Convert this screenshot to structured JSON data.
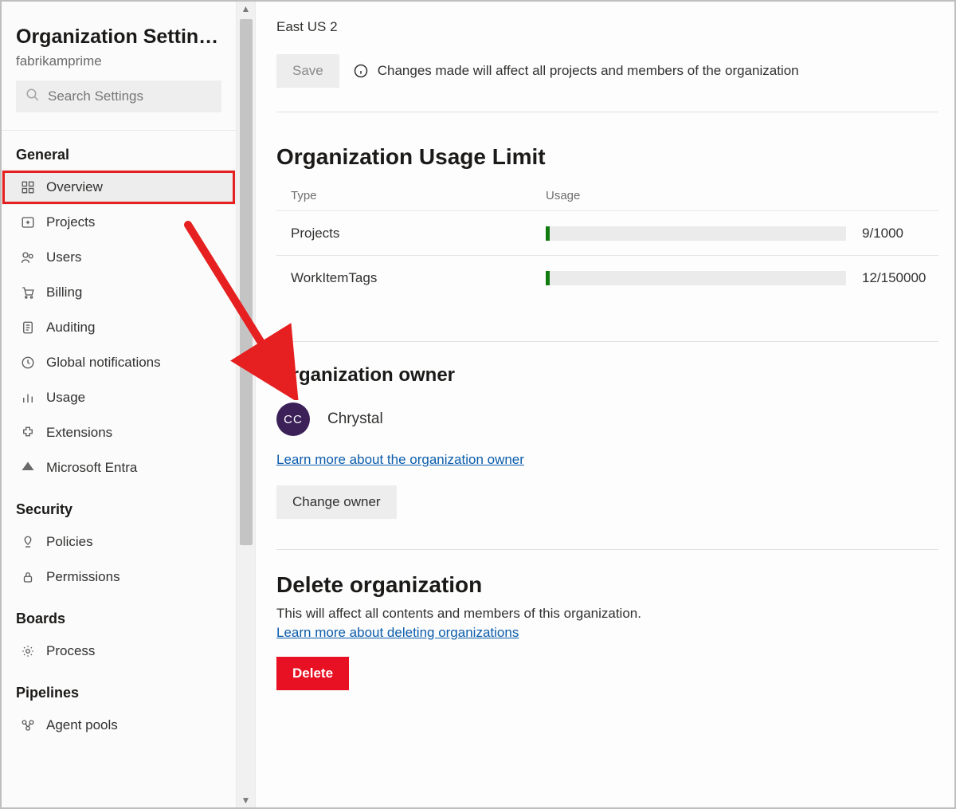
{
  "sidebar": {
    "title": "Organization Settin…",
    "subtitle": "fabrikamprime",
    "search_placeholder": "Search Settings",
    "groups": [
      {
        "name": "General",
        "items": [
          {
            "key": "overview",
            "label": "Overview",
            "selected": true,
            "highlighted": true
          },
          {
            "key": "projects",
            "label": "Projects"
          },
          {
            "key": "users",
            "label": "Users"
          },
          {
            "key": "billing",
            "label": "Billing"
          },
          {
            "key": "auditing",
            "label": "Auditing"
          },
          {
            "key": "notifications",
            "label": "Global notifications"
          },
          {
            "key": "usage",
            "label": "Usage"
          },
          {
            "key": "extensions",
            "label": "Extensions"
          },
          {
            "key": "entra",
            "label": "Microsoft Entra"
          }
        ]
      },
      {
        "name": "Security",
        "items": [
          {
            "key": "policies",
            "label": "Policies"
          },
          {
            "key": "permissions",
            "label": "Permissions"
          }
        ]
      },
      {
        "name": "Boards",
        "items": [
          {
            "key": "process",
            "label": "Process"
          }
        ]
      },
      {
        "name": "Pipelines",
        "items": [
          {
            "key": "agentpools",
            "label": "Agent pools"
          }
        ]
      }
    ]
  },
  "main": {
    "region": "East US 2",
    "save_label": "Save",
    "save_warning": "Changes made will affect all projects and members of the organization",
    "usage": {
      "heading": "Organization Usage Limit",
      "col_type": "Type",
      "col_usage": "Usage",
      "rows": [
        {
          "type": "Projects",
          "used": 9,
          "limit": 1000,
          "display": "9/1000"
        },
        {
          "type": "WorkItemTags",
          "used": 12,
          "limit": 150000,
          "display": "12/150000"
        }
      ]
    },
    "owner": {
      "heading": "Organization owner",
      "initials": "CC",
      "name": "Chrystal",
      "learn_more": "Learn more about the organization owner",
      "change_label": "Change owner"
    },
    "delete": {
      "heading": "Delete organization",
      "description": "This will affect all contents and members of this organization.",
      "learn_more": "Learn more about deleting organizations",
      "button": "Delete"
    }
  }
}
